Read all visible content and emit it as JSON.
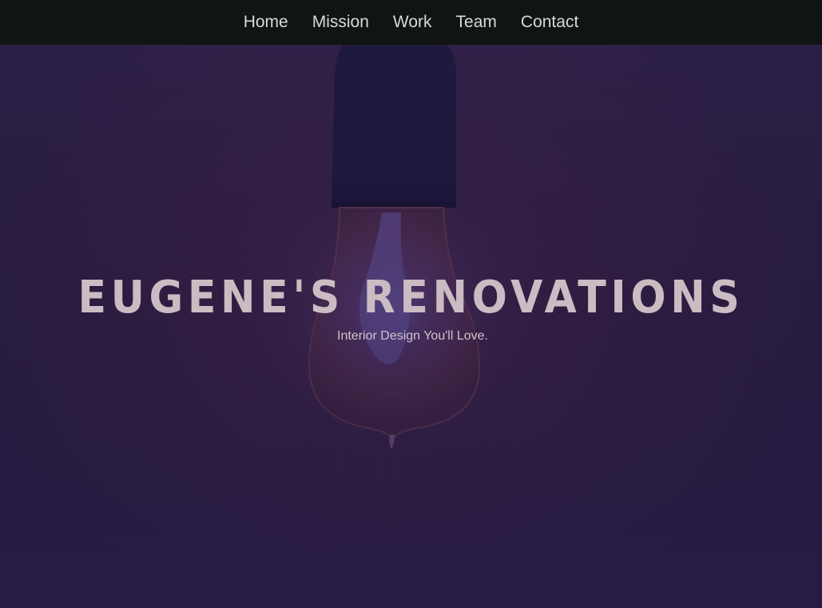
{
  "nav": {
    "items": [
      {
        "label": "Home"
      },
      {
        "label": "Mission"
      },
      {
        "label": "Work"
      },
      {
        "label": "Team"
      },
      {
        "label": "Contact"
      }
    ]
  },
  "hero": {
    "title": "EUGENE'S RENOVATIONS",
    "subtitle": "Interior Design You'll Love.",
    "background_image": "light-bulb"
  },
  "colors": {
    "nav_background": "#101413",
    "hero_overlay": "#2f1f45",
    "title_color": "#cbbcc3",
    "nav_text": "#d9d9d9"
  }
}
